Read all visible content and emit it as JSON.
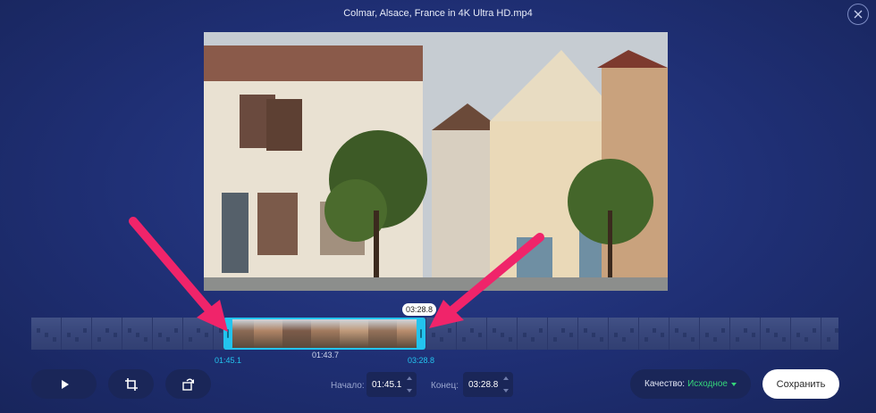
{
  "window": {
    "title": "Colmar, Alsace, France in 4K Ultra HD.mp4",
    "close_icon": "close-icon"
  },
  "timeline": {
    "end_bubble": "03:28.8",
    "start_time": "01:45.1",
    "current_time": "01:43.7",
    "end_time": "03:28.8",
    "accent_color": "#23c4ee"
  },
  "controls": {
    "play_icon": "play-icon",
    "crop_icon": "crop-icon",
    "rotate_icon": "rotate-icon",
    "start_label": "Начало:",
    "start_value": "01:45.1",
    "end_label": "Конец:",
    "end_value": "03:28.8",
    "quality_label": "Качество:",
    "quality_value": "Исходное",
    "save_label": "Сохранить"
  },
  "annotations": {
    "arrow_color": "#f0246a"
  }
}
